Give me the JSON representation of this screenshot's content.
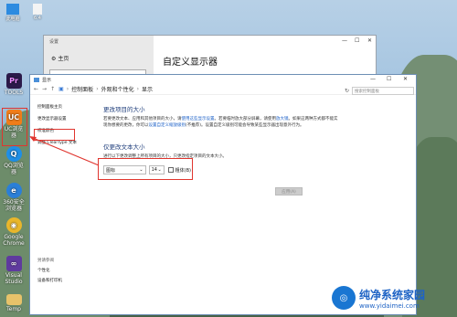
{
  "desktop": {
    "top_icons": [
      {
        "label": "此电脑",
        "icon": "computer-icon"
      },
      {
        "label": "6.4",
        "icon": "file-icon"
      }
    ],
    "left_icons": [
      {
        "label": "TOOLS",
        "icon": "premiere-icon",
        "color": "#2b1a4a",
        "glyph": "Pr"
      },
      {
        "label": "UC浏览器",
        "icon": "uc-browser-icon",
        "color": "#f07d1a",
        "glyph": "UC"
      },
      {
        "label": "QQ浏览器",
        "icon": "qq-browser-icon",
        "color": "#1f8fe6",
        "glyph": "Q"
      },
      {
        "label": "360安全浏览器",
        "icon": "360-browser-icon",
        "color": "#2b7fd7",
        "glyph": "e"
      },
      {
        "label": "Google Chrome",
        "icon": "chrome-icon",
        "color": "#e9b62b",
        "glyph": "◉"
      },
      {
        "label": "Visual Studio",
        "icon": "visual-studio-icon",
        "color": "#5f3a9e",
        "glyph": "∞"
      },
      {
        "label": "Temp",
        "icon": "folder-icon",
        "color": "#e7c26a",
        "glyph": ""
      }
    ]
  },
  "settings": {
    "title": "设置",
    "home": "主页",
    "heading": "自定义显示器",
    "controls": [
      "—",
      "☐",
      "✕"
    ]
  },
  "display": {
    "title": "显示",
    "controls": [
      "—",
      "☐",
      "✕"
    ],
    "breadcrumbs": [
      "控制面板",
      "外观和个性化",
      "显示"
    ],
    "search_placeholder": "搜索控制面板",
    "left_nav": [
      "控制面板主页",
      "更改显示器设置",
      "校准颜色",
      "调整 ClearType 文本"
    ],
    "see_also": [
      "另请参阅",
      "个性化",
      "设备和打印机"
    ],
    "section1_title": "更改项目的大小",
    "section1_text_a": "若要更改文本、应用和其他项目的大小，请",
    "section1_link_a": "使用这些显示设置",
    "section1_text_b": "。若要临时放大部分屏幕，请使用",
    "section1_link_b": "放大镜",
    "section1_text_c": "。如果这两种方式都不能实现你想要的更改，你可以",
    "section1_link_c": "设置自定义缩放级别",
    "section1_text_d": "(不推荐)。设置自定义级别可能会导致某些显示器出现意外行为。",
    "section2_title": "仅更改文本大小",
    "section2_text": "进行以下更改调整上所有项目的大小，只更改指定项目的文本大小。",
    "item_select": "图标",
    "size_select": "14",
    "bold_label": "粗体(B)",
    "apply_label": "应用(A)"
  },
  "watermark": {
    "title": "纯净系统家园",
    "url": "www.yidaimei.com"
  },
  "colors": {
    "highlight": "#e0352e",
    "accent": "#1e3d7b",
    "link": "#1a5fc7"
  }
}
